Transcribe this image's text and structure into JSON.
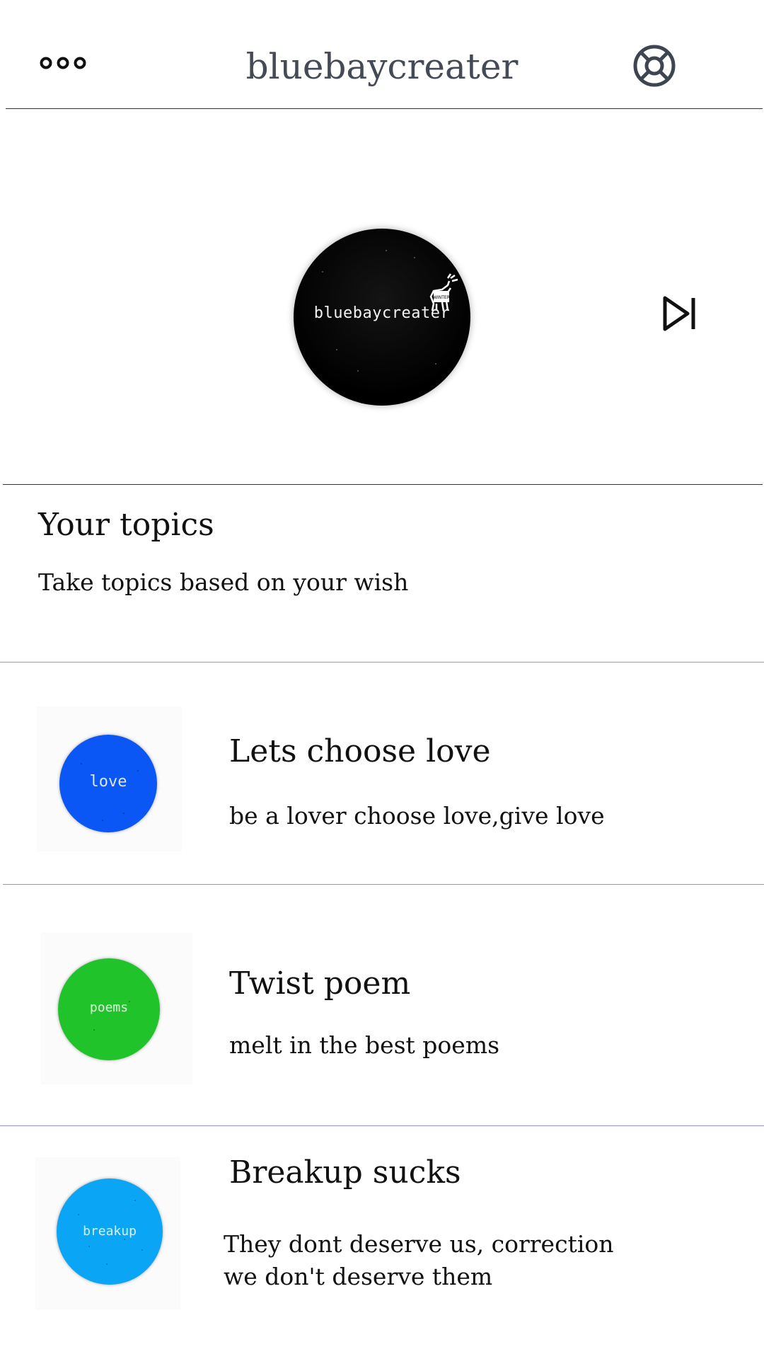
{
  "header": {
    "title": "bluebaycreater",
    "menu_icon": "more-dots-icon",
    "help_icon": "lifebuoy-icon"
  },
  "profile": {
    "photo_text": "bluebaycreater",
    "badge_text": "WINTER",
    "next_icon": "skip-next-icon"
  },
  "topics_section": {
    "title": "Your topics",
    "subtitle": "Take topics based on your wish"
  },
  "topics": [
    {
      "thumb_label": "love",
      "thumb_color": "#0a57f5",
      "title": "Lets choose love",
      "description": "be a  lover choose love,give love"
    },
    {
      "thumb_label": "poems",
      "thumb_color": "#20c42a",
      "title": "Twist poem",
      "description": "melt in the best poems"
    },
    {
      "thumb_label": "breakup",
      "thumb_color": "#0aa6f5",
      "title": "Breakup sucks",
      "description": "They dont deserve us, correction\n we don't deserve them"
    }
  ],
  "colors": {
    "header_text": "#444a56",
    "divider_accent": "#9b8fe6"
  }
}
